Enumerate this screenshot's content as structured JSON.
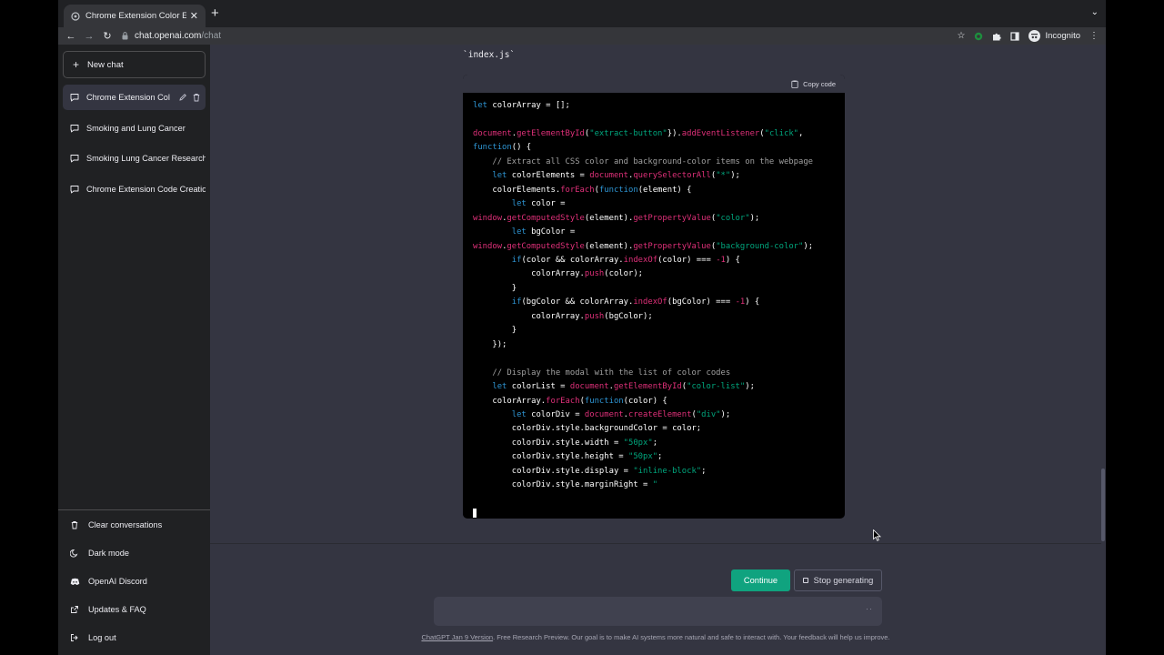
{
  "browser": {
    "tab_title": "Chrome Extension Color Extrac",
    "url_host": "chat.openai.com",
    "url_path": "/chat",
    "profile_label": "Incognito"
  },
  "sidebar": {
    "new_chat_label": "New chat",
    "conversations": [
      {
        "label": "Chrome Extension Col"
      },
      {
        "label": "Smoking and Lung Cancer"
      },
      {
        "label": "Smoking Lung Cancer Research"
      },
      {
        "label": "Chrome Extension Code Creation"
      }
    ],
    "menu": {
      "clear": "Clear conversations",
      "dark_mode": "Dark mode",
      "discord": "OpenAI Discord",
      "updates": "Updates & FAQ",
      "logout": "Log out"
    }
  },
  "main": {
    "code_caption": "`index.js`",
    "copy_label": "Copy code"
  },
  "bottom": {
    "continue_label": "Continue",
    "stop_label": "Stop generating",
    "prompt_dots": "··",
    "footer_link": "ChatGPT Jan 9 Version",
    "footer_text": ". Free Research Preview. Our goal is to make AI systems more natural and safe to interact with. Your feedback will help us improve."
  },
  "code_lines": [
    [
      [
        "kw",
        "let"
      ],
      [
        "",
        "colorArray = [];"
      ]
    ],
    [],
    [
      [
        "fn",
        "document"
      ],
      [
        "",
        "."
      ],
      [
        "fn",
        "getElementById"
      ],
      [
        "",
        "("
      ],
      [
        "st",
        "\"extract-button\""
      ],
      [
        "",
        "})."
      ],
      [
        "fn",
        "addEventListener"
      ],
      [
        "",
        "("
      ],
      [
        "st",
        "\"click\""
      ],
      [
        "",
        ","
      ]
    ],
    [
      [
        "kw",
        "function"
      ],
      [
        "",
        "() {"
      ]
    ],
    [
      [
        "",
        "    "
      ],
      [
        "cm",
        "// Extract all CSS color and background-color items on the webpage"
      ]
    ],
    [
      [
        "",
        "    "
      ],
      [
        "kw",
        "let"
      ],
      [
        "",
        "colorElements = "
      ],
      [
        "fn",
        "document"
      ],
      [
        "",
        "."
      ],
      [
        "fn",
        "querySelectorAll"
      ],
      [
        "",
        "("
      ],
      [
        "st",
        "\"*\""
      ],
      [
        "",
        ");"
      ]
    ],
    [
      [
        "",
        "    colorElements."
      ],
      [
        "fn",
        "forEach"
      ],
      [
        "",
        "("
      ],
      [
        "kw",
        "function"
      ],
      [
        "",
        "(element) {"
      ]
    ],
    [
      [
        "",
        "        "
      ],
      [
        "kw",
        "let"
      ],
      [
        "",
        "color ="
      ]
    ],
    [
      [
        "fn",
        "window"
      ],
      [
        "",
        "."
      ],
      [
        "fn",
        "getComputedStyle"
      ],
      [
        "",
        "(element)."
      ],
      [
        "fn",
        "getPropertyValue"
      ],
      [
        "",
        "("
      ],
      [
        "st",
        "\"color\""
      ],
      [
        "",
        ");"
      ]
    ],
    [
      [
        "",
        "        "
      ],
      [
        "kw",
        "let"
      ],
      [
        "",
        "bgColor ="
      ]
    ],
    [
      [
        "fn",
        "window"
      ],
      [
        "",
        "."
      ],
      [
        "fn",
        "getComputedStyle"
      ],
      [
        "",
        "(element)."
      ],
      [
        "fn",
        "getPropertyValue"
      ],
      [
        "",
        "("
      ],
      [
        "st",
        "\"background-color\""
      ],
      [
        "",
        ");"
      ]
    ],
    [
      [
        "",
        "        "
      ],
      [
        "kw",
        "if"
      ],
      [
        "",
        "(color && colorArray."
      ],
      [
        "fn",
        "indexOf"
      ],
      [
        "",
        "(color) === "
      ],
      [
        "nm",
        "-1"
      ],
      [
        "",
        ") {"
      ]
    ],
    [
      [
        "",
        "            colorArray."
      ],
      [
        "fn",
        "push"
      ],
      [
        "",
        "(color);"
      ]
    ],
    [
      [
        "",
        "        }"
      ]
    ],
    [
      [
        "",
        "        "
      ],
      [
        "kw",
        "if"
      ],
      [
        "",
        "(bgColor && colorArray."
      ],
      [
        "fn",
        "indexOf"
      ],
      [
        "",
        "(bgColor) === "
      ],
      [
        "nm",
        "-1"
      ],
      [
        "",
        ") {"
      ]
    ],
    [
      [
        "",
        "            colorArray."
      ],
      [
        "fn",
        "push"
      ],
      [
        "",
        "(bgColor);"
      ]
    ],
    [
      [
        "",
        "        }"
      ]
    ],
    [
      [
        "",
        "    });"
      ]
    ],
    [],
    [
      [
        "",
        "    "
      ],
      [
        "cm",
        "// Display the modal with the list of color codes"
      ]
    ],
    [
      [
        "",
        "    "
      ],
      [
        "kw",
        "let"
      ],
      [
        "",
        "colorList = "
      ],
      [
        "fn",
        "document"
      ],
      [
        "",
        "."
      ],
      [
        "fn",
        "getElementById"
      ],
      [
        "",
        "("
      ],
      [
        "st",
        "\"color-list\""
      ],
      [
        "",
        ");"
      ]
    ],
    [
      [
        "",
        "    colorArray."
      ],
      [
        "fn",
        "forEach"
      ],
      [
        "",
        "("
      ],
      [
        "kw",
        "function"
      ],
      [
        "",
        "(color) {"
      ]
    ],
    [
      [
        "",
        "        "
      ],
      [
        "kw",
        "let"
      ],
      [
        "",
        "colorDiv = "
      ],
      [
        "fn",
        "document"
      ],
      [
        "",
        "."
      ],
      [
        "fn",
        "createElement"
      ],
      [
        "",
        "("
      ],
      [
        "st",
        "\"div\""
      ],
      [
        "",
        ");"
      ]
    ],
    [
      [
        "",
        "        colorDiv.style.backgroundColor = color;"
      ]
    ],
    [
      [
        "",
        "        colorDiv.style.width = "
      ],
      [
        "st",
        "\"50px\""
      ],
      [
        "",
        ";"
      ]
    ],
    [
      [
        "",
        "        colorDiv.style.height = "
      ],
      [
        "st",
        "\"50px\""
      ],
      [
        "",
        ";"
      ]
    ],
    [
      [
        "",
        "        colorDiv.style.display = "
      ],
      [
        "st",
        "\"inline-block\""
      ],
      [
        "",
        ";"
      ]
    ],
    [
      [
        "",
        "        colorDiv.style.marginRight = "
      ],
      [
        "st",
        "\""
      ]
    ]
  ],
  "icons": {
    "colors": {
      "accent": "#10a37f",
      "sidebar_bg": "#202123",
      "main_bg": "#343541",
      "code_bg": "#000000"
    }
  }
}
